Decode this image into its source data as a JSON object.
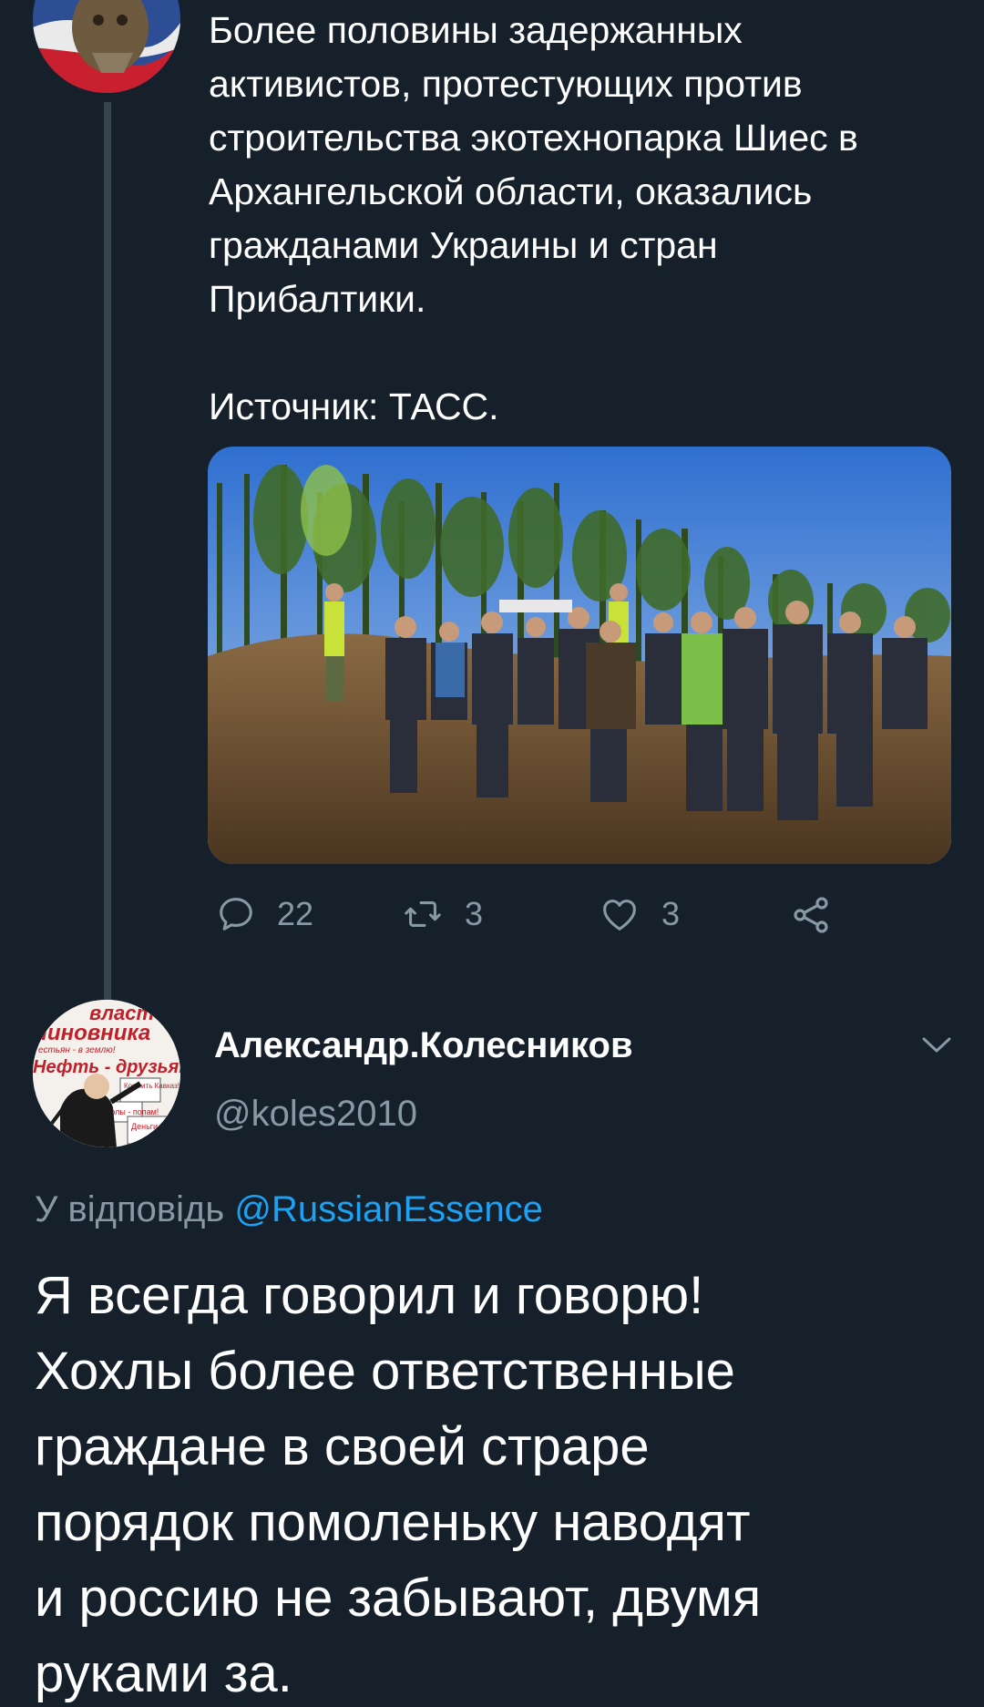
{
  "tweet1": {
    "text": "Более половины задержанных\nактивистов, протестующих против\nстроительства экотехнопарка Шиес в\nАрхангельской области, оказались\nгражданами Украины и стран\nПрибалтики.\n\nИсточник: ТАСС.",
    "actions": {
      "replies": "22",
      "retweets": "3",
      "likes": "3"
    }
  },
  "tweet2": {
    "display_name": "Александр.Колесников",
    "handle": "@koles2010",
    "reply_prefix": "У відповідь",
    "reply_mention": "@RussianEssence",
    "text": "Я всегда говорил и говорю!\nХохлы более ответственные\nграждане в своей страре\nпорядок помоленьку наводят\nи  россию не забывают, двумя\nруками за.",
    "avatar_text": {
      "line1": "власт",
      "line2": "чиновника",
      "line3": "естьян - в землю!",
      "line4": "Нефть - друзьям",
      "line5": "Кормить Кавказ!",
      "line6": "Школы - попам!",
      "line7": "Деньги в офшо"
    }
  },
  "colors": {
    "background": "#15202b",
    "secondary_text": "#8899a6",
    "link": "#1da1f2",
    "thread_line": "#38444d"
  },
  "icons": {
    "reply": "reply-icon",
    "retweet": "retweet-icon",
    "like": "heart-icon",
    "share": "share-icon",
    "menu": "chevron-down-icon"
  }
}
